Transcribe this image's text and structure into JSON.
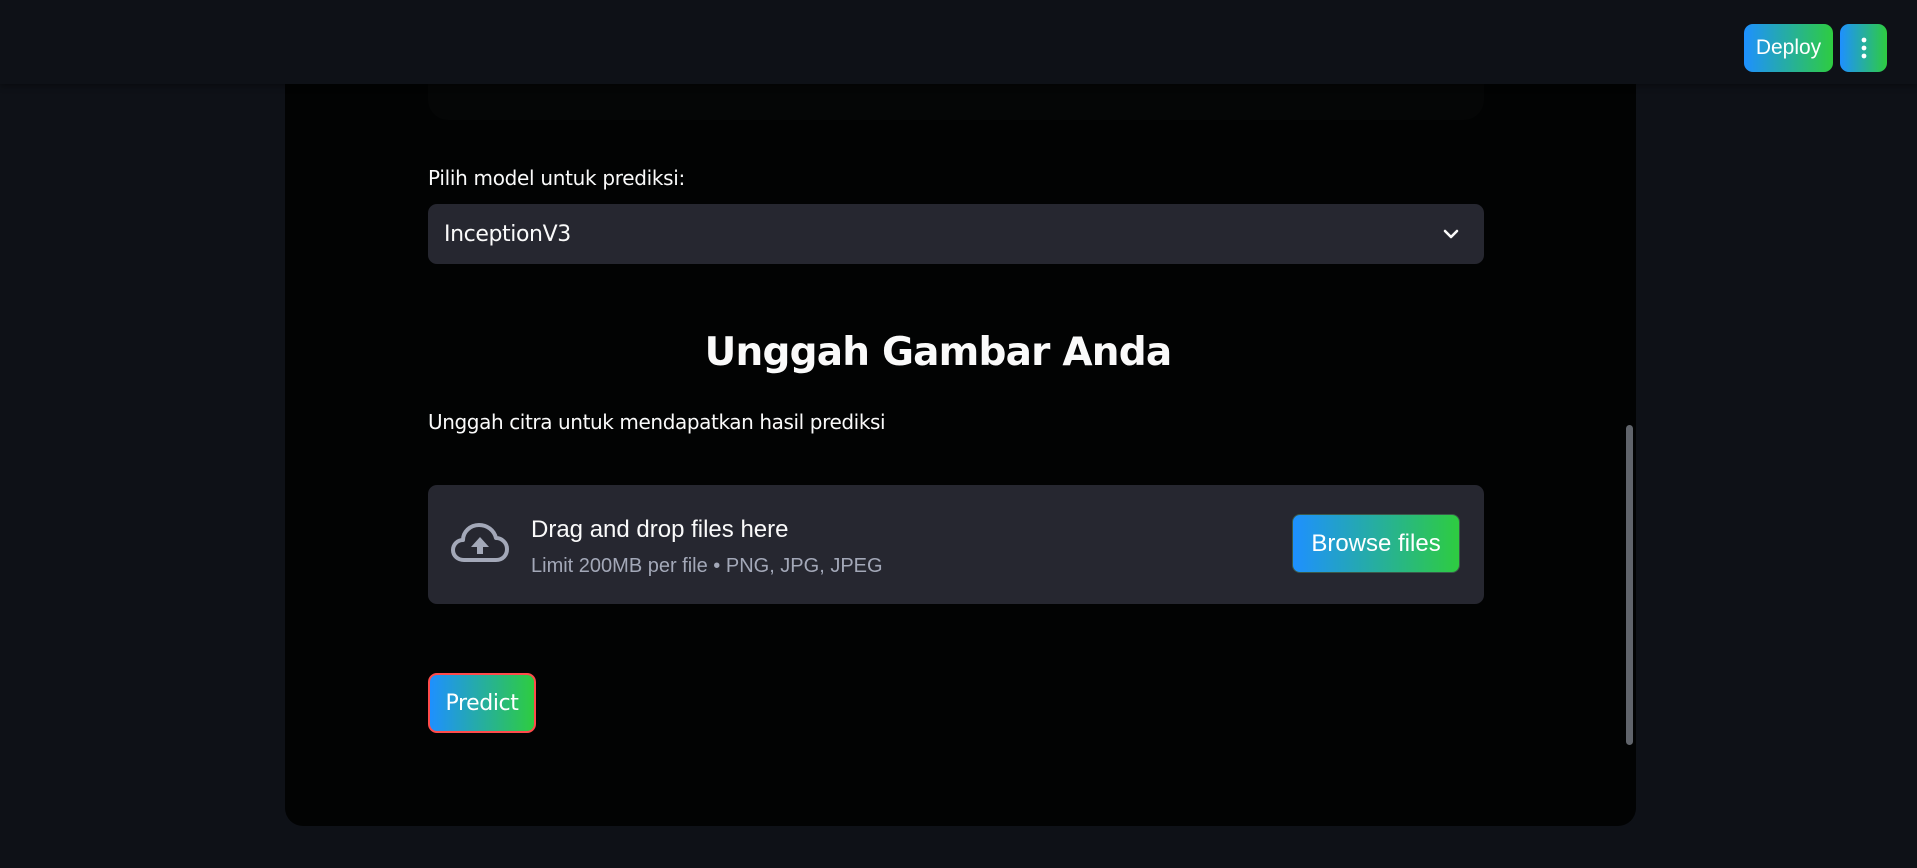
{
  "header": {
    "deploy_label": "Deploy",
    "menu_icon": "vertical-ellipsis-icon"
  },
  "model_selector": {
    "label": "Pilih model untuk prediksi:",
    "selected_value": "InceptionV3",
    "chevron_icon": "chevron-down-icon"
  },
  "upload_section": {
    "title": "Unggah Gambar Anda",
    "subtitle": "Unggah citra untuk mendapatkan hasil prediksi"
  },
  "dropzone": {
    "icon": "cloud-upload-icon",
    "title": "Drag and drop files here",
    "limit_text": "Limit 200MB per file • PNG, JPG, JPEG",
    "browse_label": "Browse files"
  },
  "actions": {
    "predict_label": "Predict"
  },
  "colors": {
    "app_background": "#0e1117",
    "card_background": "#020303",
    "input_background": "#262730",
    "gradient_start": "#1e90ff",
    "gradient_end": "#2ecc40",
    "predict_border": "#ff4b4b",
    "text_primary": "#fafafa",
    "text_muted": "#a3a8b8"
  }
}
